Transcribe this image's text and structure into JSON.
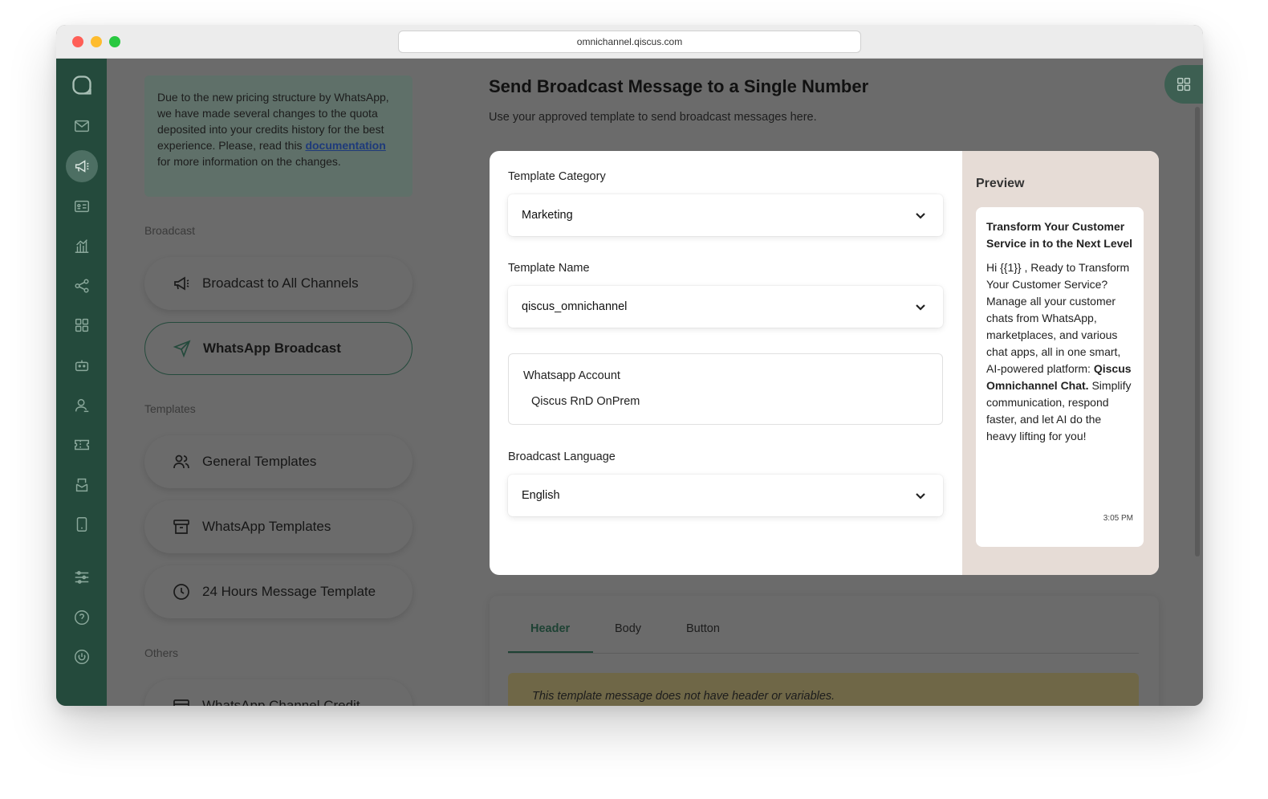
{
  "browser": {
    "url": "omnichannel.qiscus.com"
  },
  "notice": {
    "text_before": "Due to the new pricing structure by WhatsApp, we have made several changes to the quota deposited into your credits history for the best experience. Please, read this ",
    "link": "documentation",
    "text_after": " for more information on the changes."
  },
  "menu": {
    "broadcast_section": "Broadcast",
    "broadcast_all": "Broadcast to All Channels",
    "whatsapp_broadcast": "WhatsApp Broadcast",
    "templates_section": "Templates",
    "general_templates": "General Templates",
    "whatsapp_templates": "WhatsApp Templates",
    "hours_template": "24 Hours Message Template",
    "others_section": "Others",
    "channel_credit": "WhatsApp Channel Credit"
  },
  "page": {
    "title": "Send Broadcast Message to a Single Number",
    "subtitle": "Use your approved template to send broadcast messages here."
  },
  "form": {
    "category_label": "Template Category",
    "category_value": "Marketing",
    "name_label": "Template Name",
    "name_value": "qiscus_omnichannel",
    "account_label": "Whatsapp Account",
    "account_value": "Qiscus RnD OnPrem",
    "language_label": "Broadcast Language",
    "language_value": "English"
  },
  "preview": {
    "title": "Preview",
    "message_title": "Transform Your Customer Service in to the Next Level",
    "body_before": "Hi {{1}} , Ready to Transform Your Customer Service? Manage all your customer chats from WhatsApp, marketplaces, and various chat apps, all in one smart, AI-powered platform: ",
    "body_bold": "Qiscus Omnichannel Chat.",
    "body_after": " Simplify communication, respond faster, and let AI do the heavy lifting for you!",
    "time": "3:05 PM"
  },
  "tabs": {
    "header": "Header",
    "body": "Body",
    "button": "Button",
    "note": "This template message does not have header or variables."
  },
  "colors": {
    "rail": "#244a3c",
    "accent": "#1e4234",
    "preview_bg": "#e6dcd6",
    "overlay": "#6b6b6b"
  }
}
